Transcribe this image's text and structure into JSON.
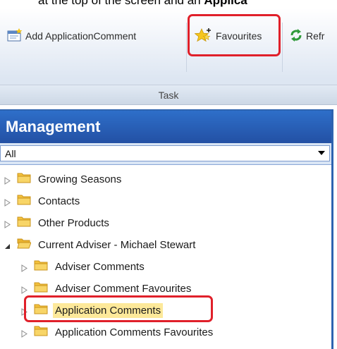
{
  "doc_text": {
    "fragment": "at the top of the screen and an",
    "bold_fragment": "Applica"
  },
  "ribbon": {
    "buttons": [
      {
        "label": "Add ApplicationComment",
        "icon": "add-comment-icon"
      },
      {
        "label": "Favourites",
        "icon": "star-plus-icon"
      },
      {
        "label": "Refr",
        "icon": "refresh-icon"
      }
    ],
    "group_label": "Task"
  },
  "panel": {
    "title": "Management",
    "filter_value": "All"
  },
  "tree": {
    "nodes": [
      {
        "label": "Growing Seasons",
        "expanded": false,
        "level": 0
      },
      {
        "label": "Contacts",
        "expanded": false,
        "level": 0
      },
      {
        "label": "Other Products",
        "expanded": false,
        "level": 0
      },
      {
        "label": "Current Adviser - Michael Stewart",
        "expanded": true,
        "level": 0
      },
      {
        "label": "Adviser Comments",
        "expanded": false,
        "level": 1
      },
      {
        "label": "Adviser Comment Favourites",
        "expanded": false,
        "level": 1
      },
      {
        "label": "Application Comments",
        "expanded": false,
        "level": 1,
        "selected": true
      },
      {
        "label": "Application Comments Favourites",
        "expanded": false,
        "level": 1
      }
    ]
  },
  "colors": {
    "panel_header": "#2350a4",
    "selection": "#fde99a",
    "callout": "#e0202a",
    "folder": "#f4c23d"
  }
}
